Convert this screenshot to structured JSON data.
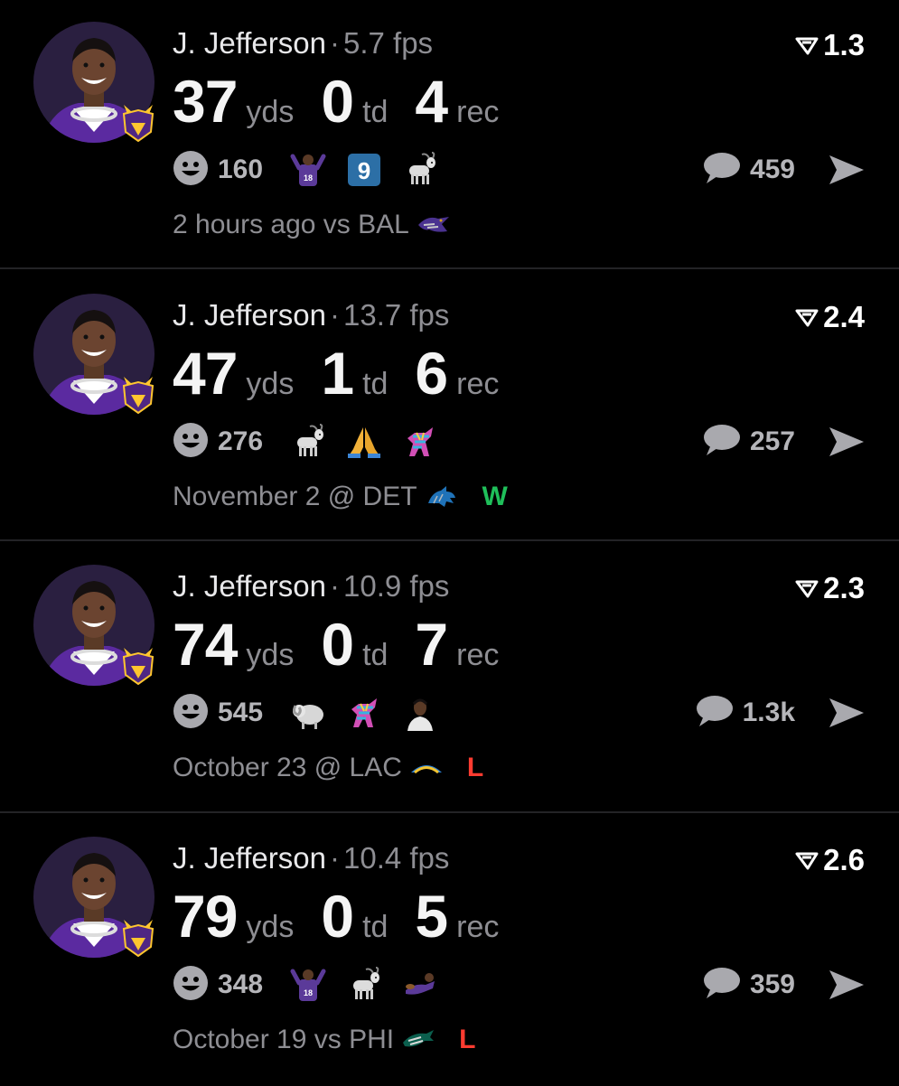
{
  "colors": {
    "background": "#000000",
    "divider": "#232326",
    "muted_text": "#8e8e93",
    "win": "#1fbf5a",
    "loss": "#ff3b30",
    "vikings_purple": "#4f2683",
    "vikings_gold": "#ffc62f"
  },
  "posts": [
    {
      "player": "J. Jefferson",
      "separator": "·",
      "fps": "5.7 fps",
      "score": "1.3",
      "stats": [
        {
          "value": "37",
          "unit": "yds"
        },
        {
          "value": "0",
          "unit": "td"
        },
        {
          "value": "4",
          "unit": "rec"
        }
      ],
      "reaction_icon": "smiley-face-icon",
      "reactions": "160",
      "emojis": [
        "player-18-emoji",
        "number-9-badge-emoji",
        "goat-emoji"
      ],
      "emoji_9_label": "9",
      "comments": "459",
      "meta": "2 hours ago vs BAL",
      "team_logo": "ravens-logo-icon",
      "result": "",
      "result_color": ""
    },
    {
      "player": "J. Jefferson",
      "separator": "·",
      "fps": "13.7 fps",
      "score": "2.4",
      "stats": [
        {
          "value": "47",
          "unit": "yds"
        },
        {
          "value": "1",
          "unit": "td"
        },
        {
          "value": "6",
          "unit": "rec"
        }
      ],
      "reaction_icon": "smiley-face-icon",
      "reactions": "276",
      "emojis": [
        "goat-emoji",
        "praying-hands-emoji",
        "pinata-emoji"
      ],
      "comments": "257",
      "meta": "November 2 @ DET",
      "team_logo": "lions-logo-icon",
      "result": "W",
      "result_color": "#1fbf5a"
    },
    {
      "player": "J. Jefferson",
      "separator": "·",
      "fps": "10.9 fps",
      "score": "2.3",
      "stats": [
        {
          "value": "74",
          "unit": "yds"
        },
        {
          "value": "0",
          "unit": "td"
        },
        {
          "value": "7",
          "unit": "rec"
        }
      ],
      "reaction_icon": "smiley-face-icon",
      "reactions": "545",
      "emojis": [
        "ram-emoji",
        "pinata-emoji",
        "player-photo-emoji"
      ],
      "comments": "1.3k",
      "meta": "October 23 @ LAC",
      "team_logo": "chargers-logo-icon",
      "result": "L",
      "result_color": "#ff3b30"
    },
    {
      "player": "J. Jefferson",
      "separator": "·",
      "fps": "10.4 fps",
      "score": "2.6",
      "stats": [
        {
          "value": "79",
          "unit": "yds"
        },
        {
          "value": "0",
          "unit": "td"
        },
        {
          "value": "5",
          "unit": "rec"
        }
      ],
      "reaction_icon": "smiley-face-icon",
      "reactions": "348",
      "emojis": [
        "player-18-emoji",
        "goat-emoji",
        "player-diving-emoji"
      ],
      "comments": "359",
      "meta": "October 19 vs PHI",
      "team_logo": "eagles-logo-icon",
      "result": "L",
      "result_color": "#ff3b30"
    }
  ]
}
